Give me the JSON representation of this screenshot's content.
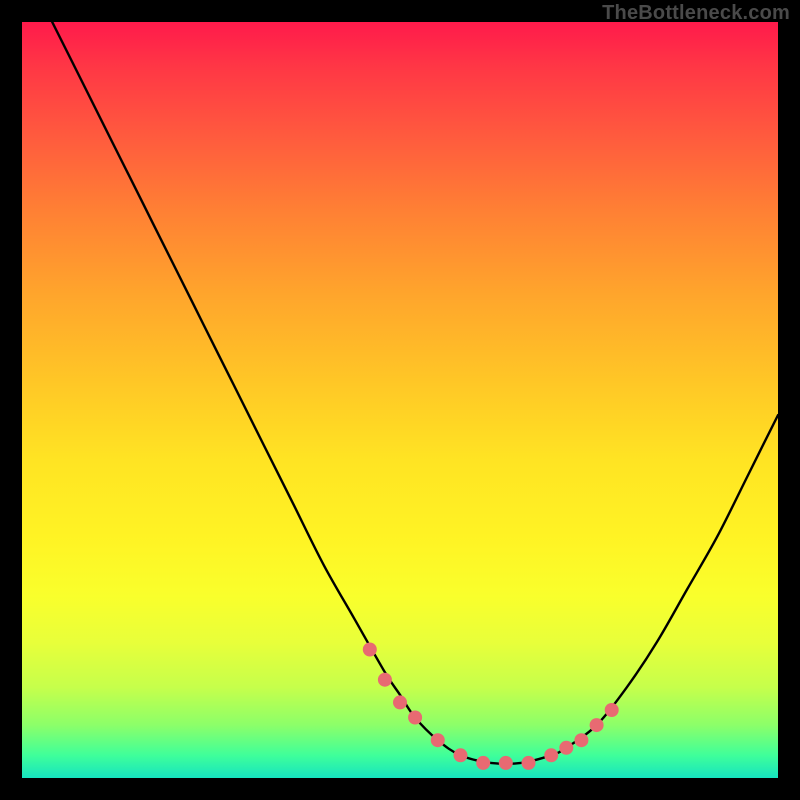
{
  "attribution": "TheBottleneck.com",
  "chart_data": {
    "type": "line",
    "title": "",
    "xlabel": "",
    "ylabel": "",
    "xlim": [
      0,
      100
    ],
    "ylim": [
      0,
      100
    ],
    "series": [
      {
        "name": "bottleneck-curve",
        "x": [
          4,
          8,
          12,
          16,
          20,
          24,
          28,
          32,
          36,
          40,
          44,
          48,
          50,
          52,
          55,
          58,
          62,
          66,
          70,
          72,
          76,
          80,
          84,
          88,
          92,
          96,
          100
        ],
        "values": [
          100,
          92,
          84,
          76,
          68,
          60,
          52,
          44,
          36,
          28,
          21,
          14,
          11,
          8,
          5,
          3,
          2,
          2,
          3,
          4,
          7,
          12,
          18,
          25,
          32,
          40,
          48
        ]
      }
    ],
    "markers": {
      "name": "highlight-points",
      "x": [
        46,
        48,
        50,
        52,
        55,
        58,
        61,
        64,
        67,
        70,
        72,
        74,
        76,
        78
      ],
      "values": [
        17,
        13,
        10,
        8,
        5,
        3,
        2,
        2,
        2,
        3,
        4,
        5,
        7,
        9
      ],
      "color": "#e86a72",
      "radius": 7
    },
    "gradient_stops": [
      {
        "pos": 0,
        "color": "#ff1a4b"
      },
      {
        "pos": 50,
        "color": "#ffe423"
      },
      {
        "pos": 100,
        "color": "#16e4c0"
      }
    ]
  }
}
